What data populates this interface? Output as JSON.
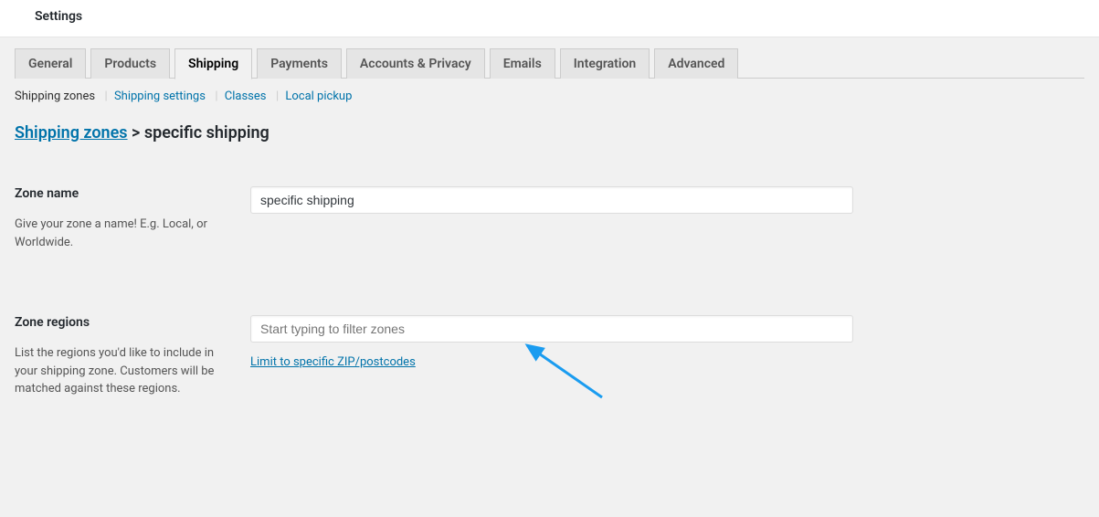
{
  "header": {
    "title": "Settings"
  },
  "tabs": [
    {
      "label": "General"
    },
    {
      "label": "Products"
    },
    {
      "label": "Shipping",
      "active": true
    },
    {
      "label": "Payments"
    },
    {
      "label": "Accounts & Privacy"
    },
    {
      "label": "Emails"
    },
    {
      "label": "Integration"
    },
    {
      "label": "Advanced"
    }
  ],
  "subtabs": {
    "zones": "Shipping zones",
    "settings": "Shipping settings",
    "classes": "Classes",
    "pickup": "Local pickup"
  },
  "breadcrumb": {
    "link": "Shipping zones",
    "separator": ">",
    "current": "specific shipping"
  },
  "zoneName": {
    "label": "Zone name",
    "hint": "Give your zone a name! E.g. Local, or Worldwide.",
    "value": "specific shipping"
  },
  "zoneRegions": {
    "label": "Zone regions",
    "hint": "List the regions you'd like to include in your shipping zone. Customers will be matched against these regions.",
    "placeholder": "Start typing to filter zones",
    "zipLink": "Limit to specific ZIP/postcodes"
  }
}
